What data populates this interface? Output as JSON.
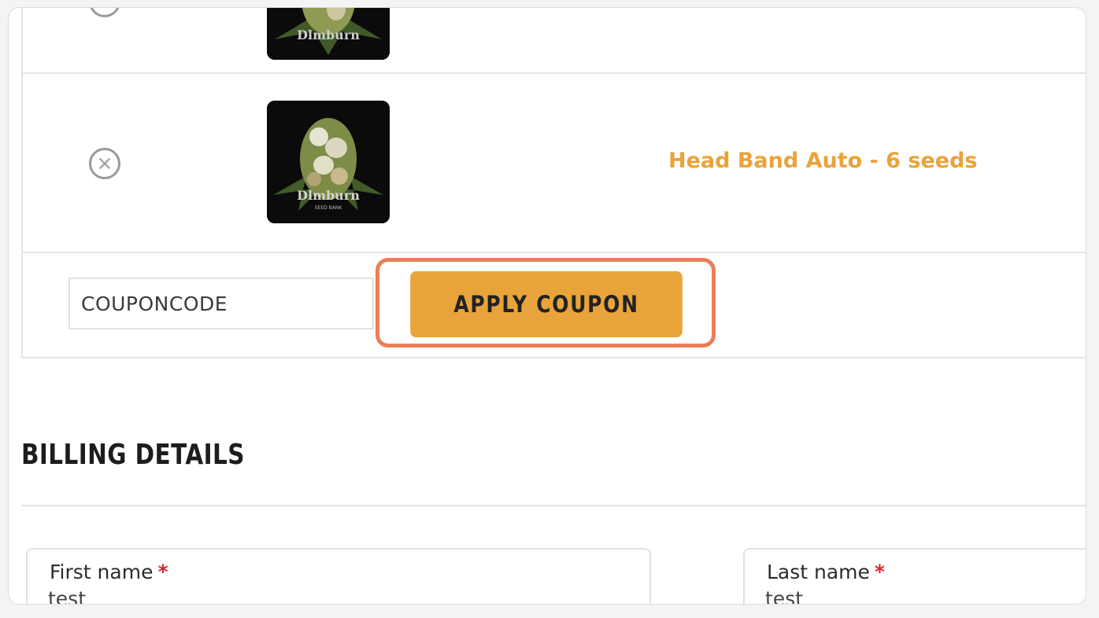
{
  "cart": {
    "items": [
      {
        "remove_icon": "remove-circle-icon",
        "image": "product-thumbnail",
        "name": ""
      },
      {
        "remove_icon": "remove-circle-icon",
        "image": "product-thumbnail",
        "name": "Head Band Auto - 6 seeds"
      }
    ],
    "coupon": {
      "value": "COUPONCODE",
      "apply_label": "APPLY COUPON"
    }
  },
  "billing": {
    "title": "BILLING DETAILS",
    "required_marker": "*",
    "fields": [
      {
        "label": "First name",
        "value": "test"
      },
      {
        "label": "Last name",
        "value": "test"
      }
    ]
  },
  "colors": {
    "accent": "#e8a33a",
    "highlight": "#ec7e57",
    "required": "#e0222a"
  }
}
